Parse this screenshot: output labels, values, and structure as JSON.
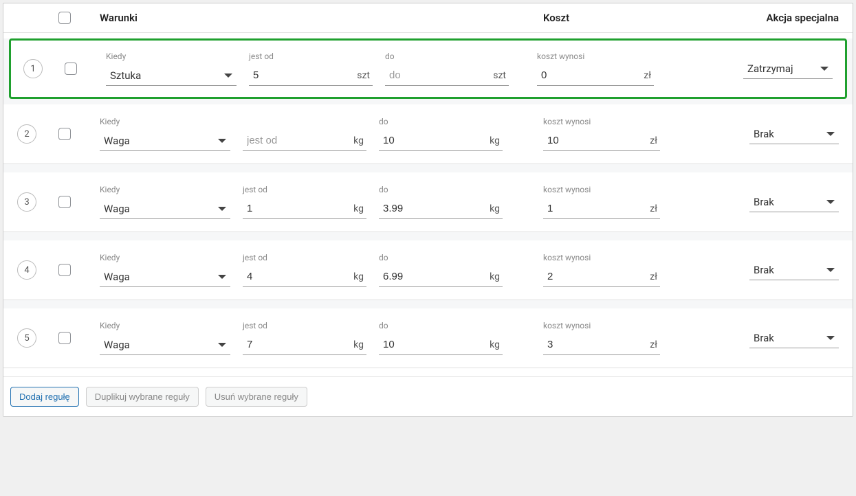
{
  "labels": {
    "conditions_header": "Warunki",
    "cost_header": "Koszt",
    "action_header": "Akcja specjalna",
    "when": "Kiedy",
    "from": "jest od",
    "to": "do",
    "cost": "koszt wynosi",
    "unit_pc": "szt",
    "unit_kg": "kg",
    "currency": "zł"
  },
  "rows": [
    {
      "num": "1",
      "highlight": true,
      "when": "Sztuka",
      "from_label": "jest od",
      "from": "5",
      "from_unit": "szt",
      "to_label": "do",
      "to": "",
      "to_placeholder": "",
      "to_unit": "szt",
      "cost_label": "koszt wynosi",
      "cost": "0",
      "action": "Zatrzymaj"
    },
    {
      "num": "2",
      "highlight": false,
      "when": "Waga",
      "from_label": "",
      "from": "",
      "from_placeholder": "jest od",
      "from_unit": "kg",
      "to_label": "do",
      "to": "10",
      "to_unit": "kg",
      "cost_label": "koszt wynosi",
      "cost": "10",
      "action": "Brak"
    },
    {
      "num": "3",
      "highlight": false,
      "when": "Waga",
      "from_label": "jest od",
      "from": "1",
      "from_unit": "kg",
      "to_label": "do",
      "to": "3.99",
      "to_unit": "kg",
      "cost_label": "koszt wynosi",
      "cost": "1",
      "action": "Brak"
    },
    {
      "num": "4",
      "highlight": false,
      "when": "Waga",
      "from_label": "jest od",
      "from": "4",
      "from_unit": "kg",
      "to_label": "do",
      "to": "6.99",
      "to_unit": "kg",
      "cost_label": "koszt wynosi",
      "cost": "2",
      "action": "Brak"
    },
    {
      "num": "5",
      "highlight": false,
      "when": "Waga",
      "from_label": "jest od",
      "from": "7",
      "from_unit": "kg",
      "to_label": "do",
      "to": "10",
      "to_unit": "kg",
      "cost_label": "koszt wynosi",
      "cost": "3",
      "action": "Brak"
    }
  ],
  "footer": {
    "add": "Dodaj regułę",
    "duplicate": "Duplikuj wybrane reguły",
    "delete": "Usuń wybrane reguły"
  }
}
